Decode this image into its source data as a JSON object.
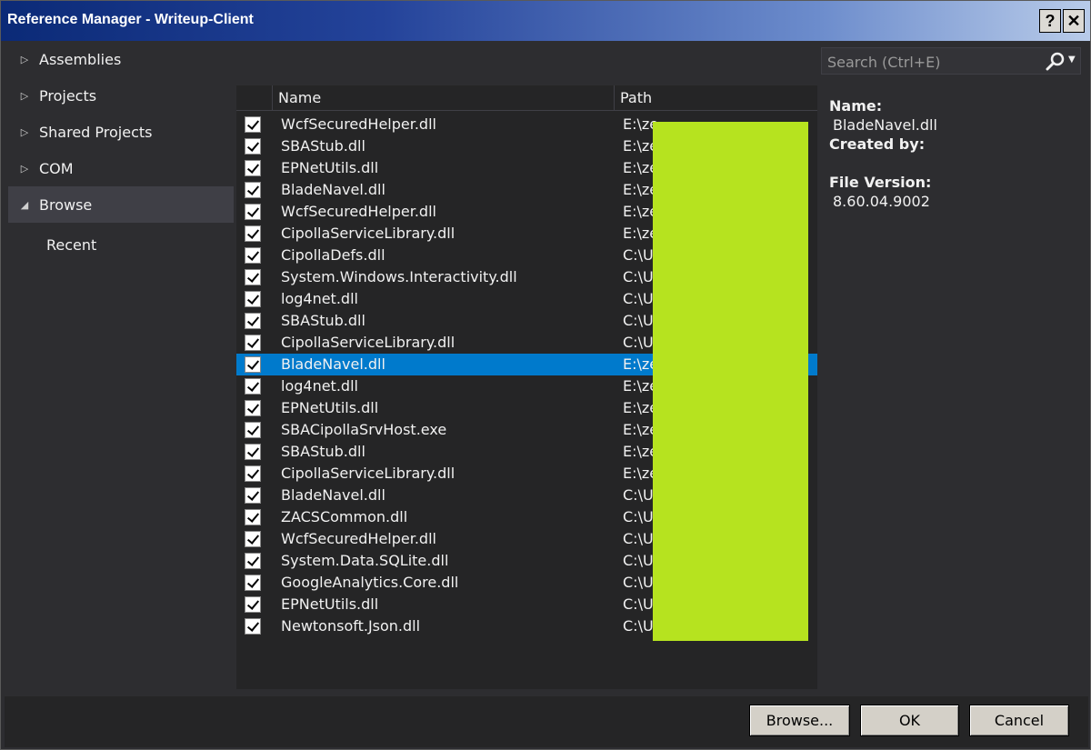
{
  "window": {
    "title": "Reference Manager - Writeup-Client",
    "help_label": "?",
    "close_label": "✕"
  },
  "nav": {
    "items": [
      {
        "label": "Assemblies",
        "arrow": "▷"
      },
      {
        "label": "Projects",
        "arrow": "▷"
      },
      {
        "label": "Shared Projects",
        "arrow": "▷"
      },
      {
        "label": "COM",
        "arrow": "▷"
      },
      {
        "label": "Browse",
        "arrow": "◢"
      },
      {
        "label": "Recent"
      }
    ]
  },
  "search": {
    "placeholder": "Search (Ctrl+E)"
  },
  "grid": {
    "columns": {
      "name": "Name",
      "path": "Path"
    },
    "rows": [
      {
        "name": "WcfSecuredHelper.dll",
        "path": "E:\\ze"
      },
      {
        "name": "SBAStub.dll",
        "path": "E:\\ze"
      },
      {
        "name": "EPNetUtils.dll",
        "path": "E:\\ze"
      },
      {
        "name": "BladeNavel.dll",
        "path": "E:\\ze"
      },
      {
        "name": "WcfSecuredHelper.dll",
        "path": "E:\\ze"
      },
      {
        "name": "CipollaServiceLibrary.dll",
        "path": "E:\\ze"
      },
      {
        "name": "CipollaDefs.dll",
        "path": "C:\\U"
      },
      {
        "name": "System.Windows.Interactivity.dll",
        "path": "C:\\U"
      },
      {
        "name": "log4net.dll",
        "path": "C:\\U"
      },
      {
        "name": "SBAStub.dll",
        "path": "C:\\U"
      },
      {
        "name": "CipollaServiceLibrary.dll",
        "path": "C:\\U"
      },
      {
        "name": "BladeNavel.dll",
        "path": "E:\\ze"
      },
      {
        "name": "log4net.dll",
        "path": "E:\\ze"
      },
      {
        "name": "EPNetUtils.dll",
        "path": "E:\\ze"
      },
      {
        "name": "SBACipollaSrvHost.exe",
        "path": "E:\\ze"
      },
      {
        "name": "SBAStub.dll",
        "path": "E:\\ze"
      },
      {
        "name": "CipollaServiceLibrary.dll",
        "path": "E:\\ze"
      },
      {
        "name": "BladeNavel.dll",
        "path": "C:\\U"
      },
      {
        "name": "ZACSCommon.dll",
        "path": "C:\\U"
      },
      {
        "name": "WcfSecuredHelper.dll",
        "path": "C:\\U"
      },
      {
        "name": "System.Data.SQLite.dll",
        "path": "C:\\U"
      },
      {
        "name": "GoogleAnalytics.Core.dll",
        "path": "C:\\U"
      },
      {
        "name": "EPNetUtils.dll",
        "path": "C:\\U"
      },
      {
        "name": "Newtonsoft.Json.dll",
        "path": "C:\\U"
      }
    ]
  },
  "details": {
    "name_label": "Name:",
    "name_value": "BladeNavel.dll",
    "created_label": "Created by:",
    "version_label": "File Version:",
    "version_value": "8.60.04.9002"
  },
  "footer": {
    "browse_label": "Browse...",
    "ok_label": "OK",
    "cancel_label": "Cancel"
  },
  "colors": {
    "selection": "#007acc",
    "redaction": "#b6e31f"
  }
}
